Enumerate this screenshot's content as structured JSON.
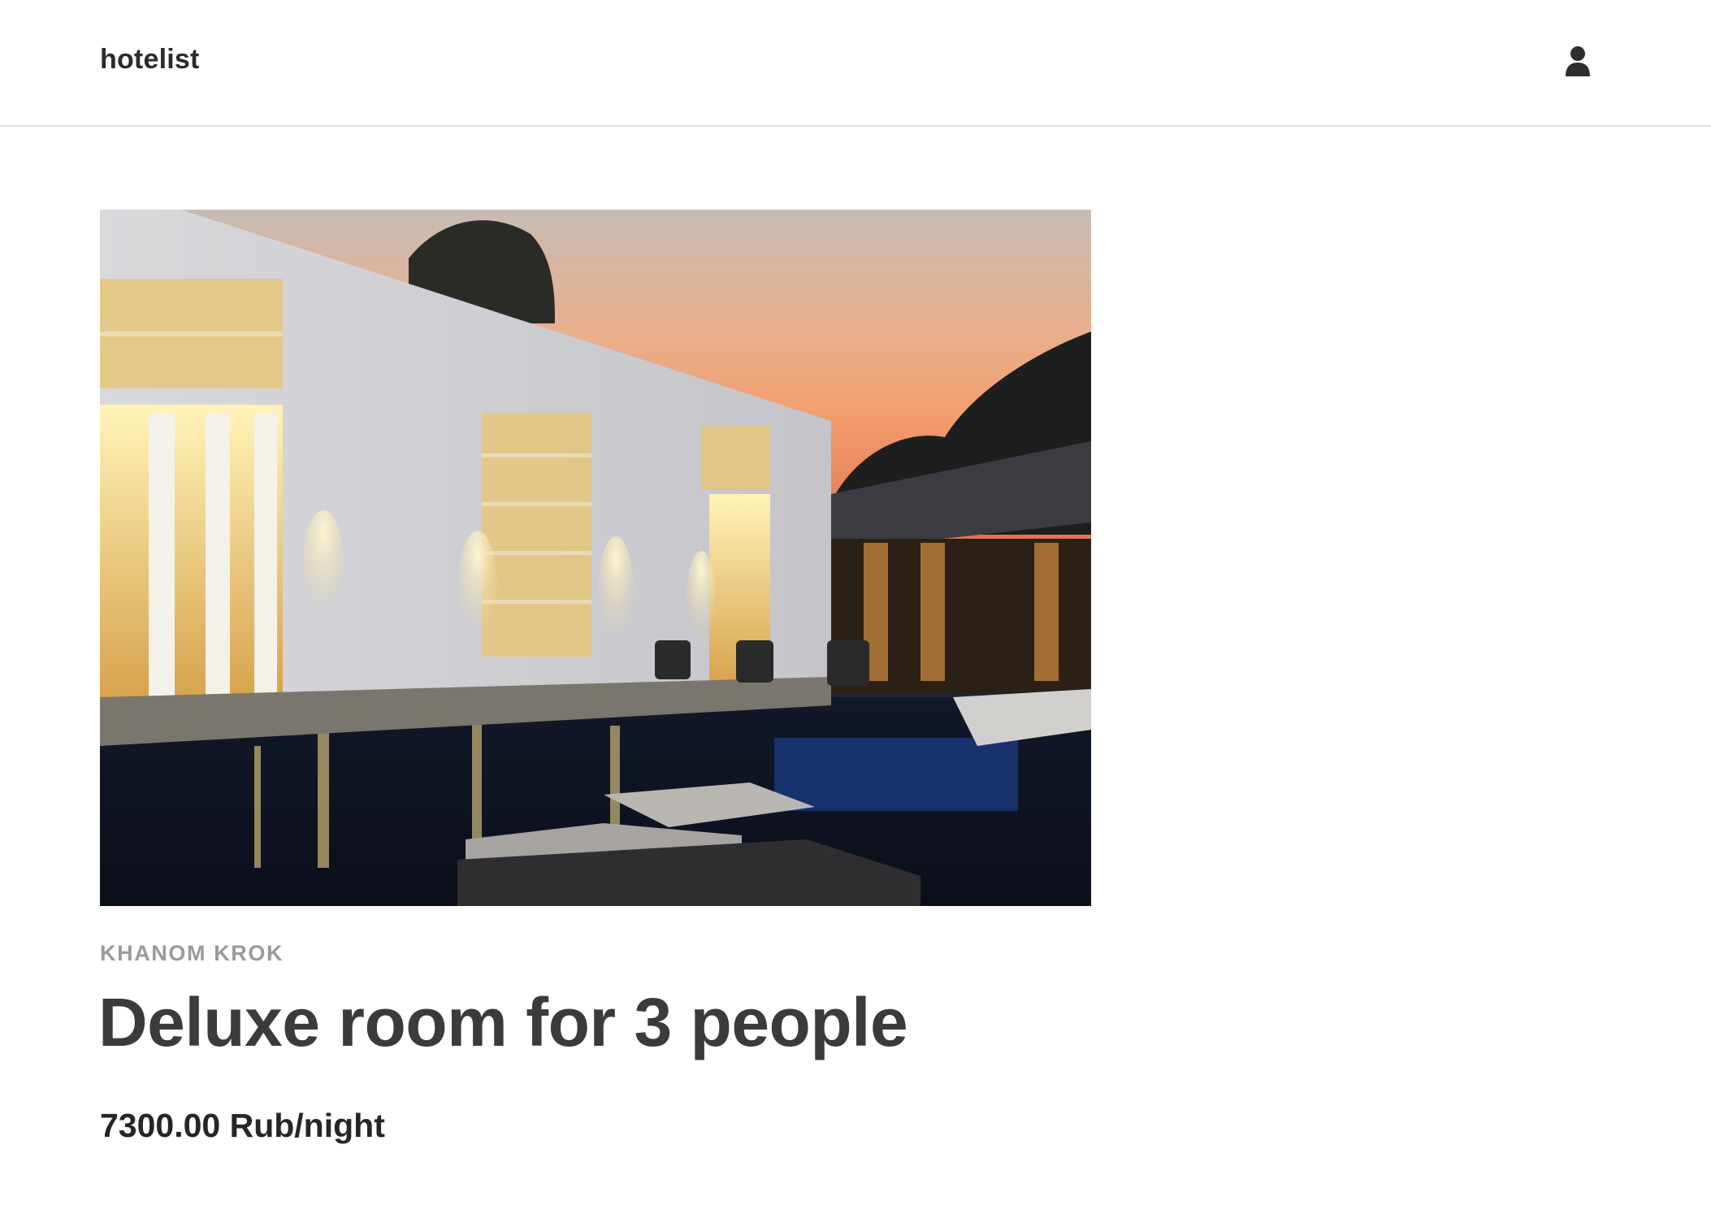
{
  "header": {
    "brand": "hotelist",
    "user_icon": "user-icon"
  },
  "listing": {
    "photo_alt": "",
    "location": "KHANOM KROK",
    "title": "Deluxe room for 3 people",
    "price": "7300.00 Rub/night"
  },
  "colors": {
    "title": "#3b3b3b",
    "location": "#9a9a9a",
    "header_border": "#e2e2e2",
    "sky_top": "#c9bbb3",
    "sky_glow": "#f29e6e"
  }
}
